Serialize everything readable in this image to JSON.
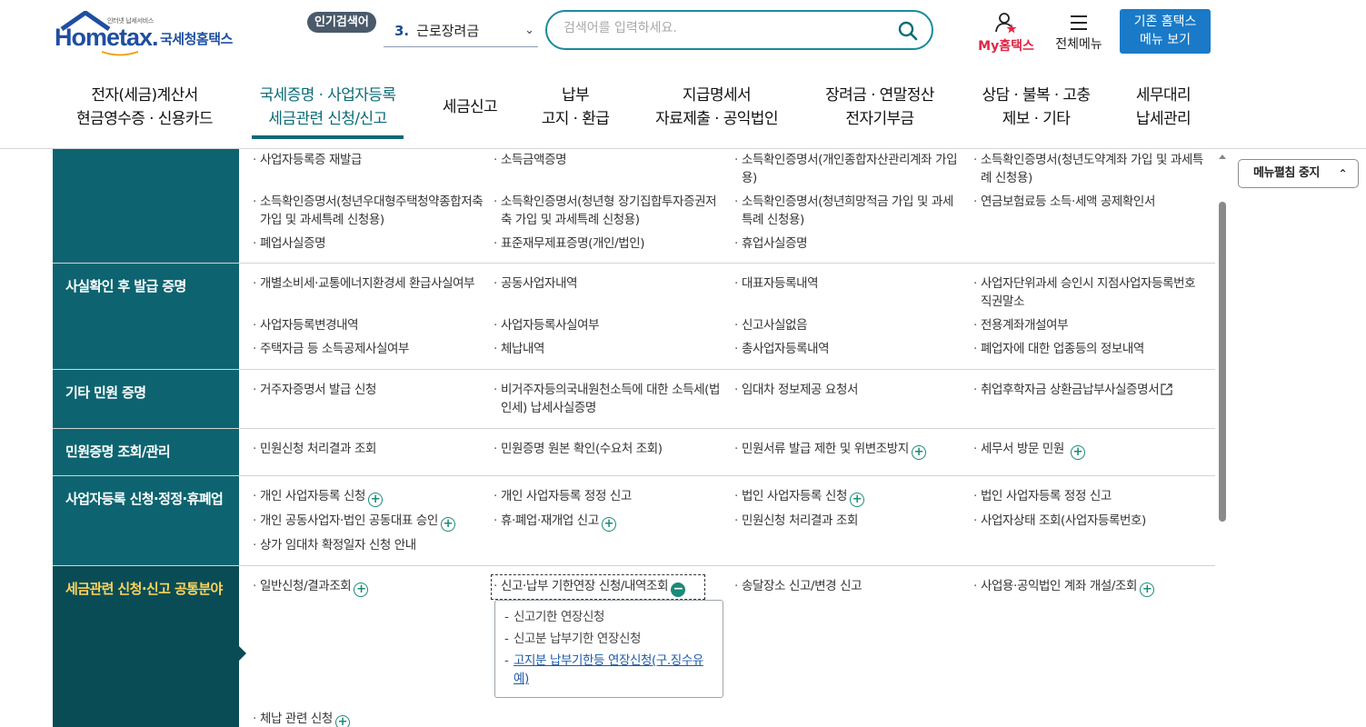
{
  "header": {
    "logo_tagline": "인터넷 납세서비스",
    "logo_wordmark": "Hometax.",
    "logo_korean": "국세청홈택스",
    "popular_badge": "인기검색어",
    "popular_rank": "3.",
    "popular_term": "근로장려금",
    "search_placeholder": "검색어를 입력하세요.",
    "mytax_label": "My홈택스",
    "allmenu_label": "전체메뉴",
    "oldmenu_line1": "기존 홈택스",
    "oldmenu_line2": "메뉴 보기"
  },
  "gnb": [
    {
      "line1": "전자(세금)계산서",
      "line2": "현금영수증 · 신용카드"
    },
    {
      "line1": "국세증명 · 사업자등록",
      "line2": "세금관련 신청/신고"
    },
    {
      "line1": "세금신고",
      "line2": ""
    },
    {
      "line1": "납부",
      "line2": "고지 · 환급"
    },
    {
      "line1": "지급명세서",
      "line2": "자료제출 · 공익법인"
    },
    {
      "line1": "장려금 · 연말정산",
      "line2": "전자기부금"
    },
    {
      "line1": "상담 · 불복 · 고충",
      "line2": "제보 · 기타"
    },
    {
      "line1": "세무대리",
      "line2": "납세관리"
    }
  ],
  "rows": [
    {
      "head": "",
      "items": [
        "사업자등록증 재발급",
        "소득금액증명",
        "소득확인증명서(개인종합자산관리계좌 가입용)",
        "소득확인증명서(청년도약계좌 가입 및 과세특례 신청용)",
        "소득확인증명서(청년우대형주택청약종합저축 가입 및 과세특례 신청용)",
        "소득확인증명서(청년형 장기집합투자증권저축 가입 및 과세특례 신청용)",
        "소득확인증명서(청년희망적금 가입 및 과세특례 신청용)",
        "연금보험료등 소득·세액 공제확인서",
        "폐업사실증명",
        "표준재무제표증명(개인/법인)",
        "휴업사실증명"
      ]
    },
    {
      "head": "사실확인 후 발급 증명",
      "items": [
        "개별소비세·교통에너지환경세 환급사실여부",
        "공동사업자내역",
        "대표자등록내역",
        "사업자단위과세 승인시 지점사업자등록번호 직권말소",
        "사업자등록변경내역",
        "사업자등록사실여부",
        "신고사실없음",
        "전용계좌개설여부",
        "주택자금 등 소득공제사실여부",
        "체납내역",
        "총사업자등록내역",
        "폐업자에 대한 업종등의 정보내역"
      ]
    },
    {
      "head": "기타 민원 증명",
      "items": [
        "거주자증명서 발급 신청",
        "비거주자등의국내원천소득에 대한 소득세(법인세) 납세사실증명",
        "임대차 정보제공 요청서",
        "취업후학자금 상환금납부사실증명서"
      ]
    },
    {
      "head": "민원증명 조회/관리",
      "items": [
        "민원신청 처리결과 조회",
        "민원증명 원본 확인(수요처 조회)",
        "민원서류 발급 제한 및 위변조방지",
        "세무서 방문 민원"
      ]
    },
    {
      "head": "사업자등록 신청·정정·휴폐업",
      "items": [
        "개인 사업자등록 신청",
        "개인 사업자등록 정정 신고",
        "법인 사업자등록 신청",
        "법인 사업자등록 정정 신고",
        "개인 공동사업자·법인 공동대표 승인",
        "휴·폐업·재개업 신고",
        "민원신청 처리결과 조회",
        "사업자상태 조회(사업자등록번호)",
        "상가 임대차 확정일자 신청 안내"
      ]
    },
    {
      "head": "세금관련 신청·신고 공통분야",
      "items": [
        "일반신청/결과조회",
        "신고·납부 기한연장 신청/내역조회",
        "송달장소 신고/변경 신고",
        "사업용·공익법인 계좌 개설/조회",
        "체납 관련 신청"
      ],
      "submenu": [
        "신고기한 연장신청",
        "신고분 납부기한 연장신청",
        "고지분 납부기한등 연장신청(구.징수유예)"
      ]
    }
  ],
  "side": {
    "folding_label": "메뉴펼침 중지"
  },
  "colors": {
    "primary": "#0d6470",
    "active_head": "#0a4c55",
    "active_text": "#ffd55a",
    "accent_blue": "#1a7ac7",
    "search_border": "#1a8a9b"
  }
}
